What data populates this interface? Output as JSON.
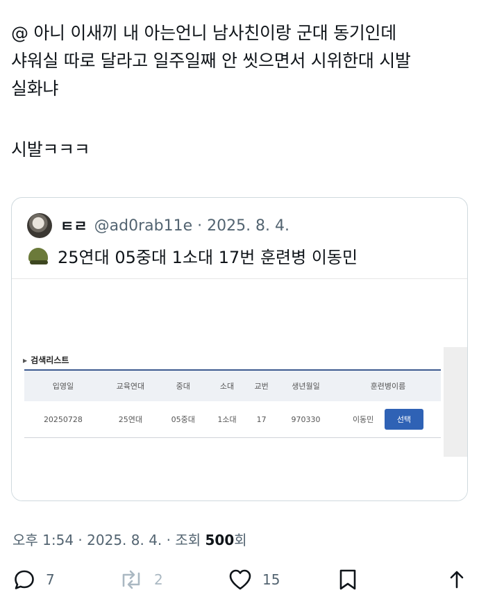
{
  "post": {
    "line1": "@ 아니 이새끼 내 아는언니 남사친이랑 군대 동기인데",
    "line2": "샤워실 따로 달라고 일주일째 안 씻으면서 시위한대 시발",
    "line3": "실화냐",
    "line4": "시발ㅋㅋㅋ"
  },
  "quote": {
    "name": "ㅌㄹ",
    "handle_date": "@ad0rab11e · 2025. 8. 4.",
    "text": "25연대 05중대 1소대 17번 훈련병 이동민",
    "avatar_icon": "avatar",
    "emoji_icon": "military-helmet-icon",
    "list_title": "검색리스트",
    "columns": [
      "입영일",
      "교육연대",
      "중대",
      "소대",
      "교번",
      "생년월일",
      "훈련병이름"
    ],
    "row": [
      "20250728",
      "25연대",
      "05중대",
      "1소대",
      "17",
      "970330",
      "이동민"
    ],
    "select_label": "선택",
    "accent": "#2f62b5"
  },
  "meta": {
    "time": "오후 1:54 · 2025. 8. 4. · 조회 ",
    "views": "500",
    "views_suffix": "회"
  },
  "actions": {
    "reply_count": "7",
    "retweet_count": "2",
    "like_count": "15"
  }
}
